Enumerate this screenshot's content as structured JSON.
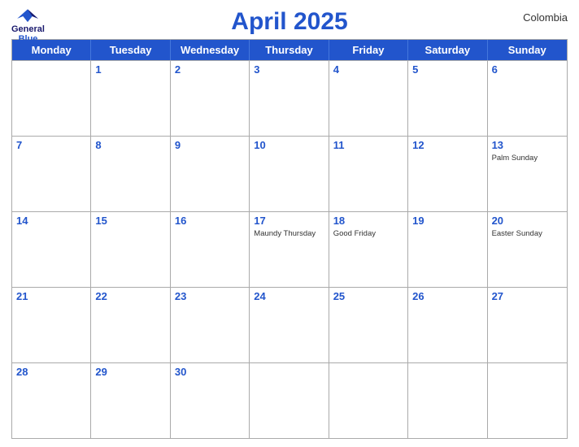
{
  "logo": {
    "general": "General",
    "blue": "Blue"
  },
  "title": "April 2025",
  "country": "Colombia",
  "header": {
    "days": [
      "Monday",
      "Tuesday",
      "Wednesday",
      "Thursday",
      "Friday",
      "Saturday",
      "Sunday"
    ]
  },
  "weeks": [
    [
      {
        "day": "",
        "holiday": ""
      },
      {
        "day": "1",
        "holiday": ""
      },
      {
        "day": "2",
        "holiday": ""
      },
      {
        "day": "3",
        "holiday": ""
      },
      {
        "day": "4",
        "holiday": ""
      },
      {
        "day": "5",
        "holiday": ""
      },
      {
        "day": "6",
        "holiday": ""
      }
    ],
    [
      {
        "day": "7",
        "holiday": ""
      },
      {
        "day": "8",
        "holiday": ""
      },
      {
        "day": "9",
        "holiday": ""
      },
      {
        "day": "10",
        "holiday": ""
      },
      {
        "day": "11",
        "holiday": ""
      },
      {
        "day": "12",
        "holiday": ""
      },
      {
        "day": "13",
        "holiday": "Palm Sunday"
      }
    ],
    [
      {
        "day": "14",
        "holiday": ""
      },
      {
        "day": "15",
        "holiday": ""
      },
      {
        "day": "16",
        "holiday": ""
      },
      {
        "day": "17",
        "holiday": "Maundy Thursday"
      },
      {
        "day": "18",
        "holiday": "Good Friday"
      },
      {
        "day": "19",
        "holiday": ""
      },
      {
        "day": "20",
        "holiday": "Easter Sunday"
      }
    ],
    [
      {
        "day": "21",
        "holiday": ""
      },
      {
        "day": "22",
        "holiday": ""
      },
      {
        "day": "23",
        "holiday": ""
      },
      {
        "day": "24",
        "holiday": ""
      },
      {
        "day": "25",
        "holiday": ""
      },
      {
        "day": "26",
        "holiday": ""
      },
      {
        "day": "27",
        "holiday": ""
      }
    ],
    [
      {
        "day": "28",
        "holiday": ""
      },
      {
        "day": "29",
        "holiday": ""
      },
      {
        "day": "30",
        "holiday": ""
      },
      {
        "day": "",
        "holiday": ""
      },
      {
        "day": "",
        "holiday": ""
      },
      {
        "day": "",
        "holiday": ""
      },
      {
        "day": "",
        "holiday": ""
      }
    ]
  ]
}
